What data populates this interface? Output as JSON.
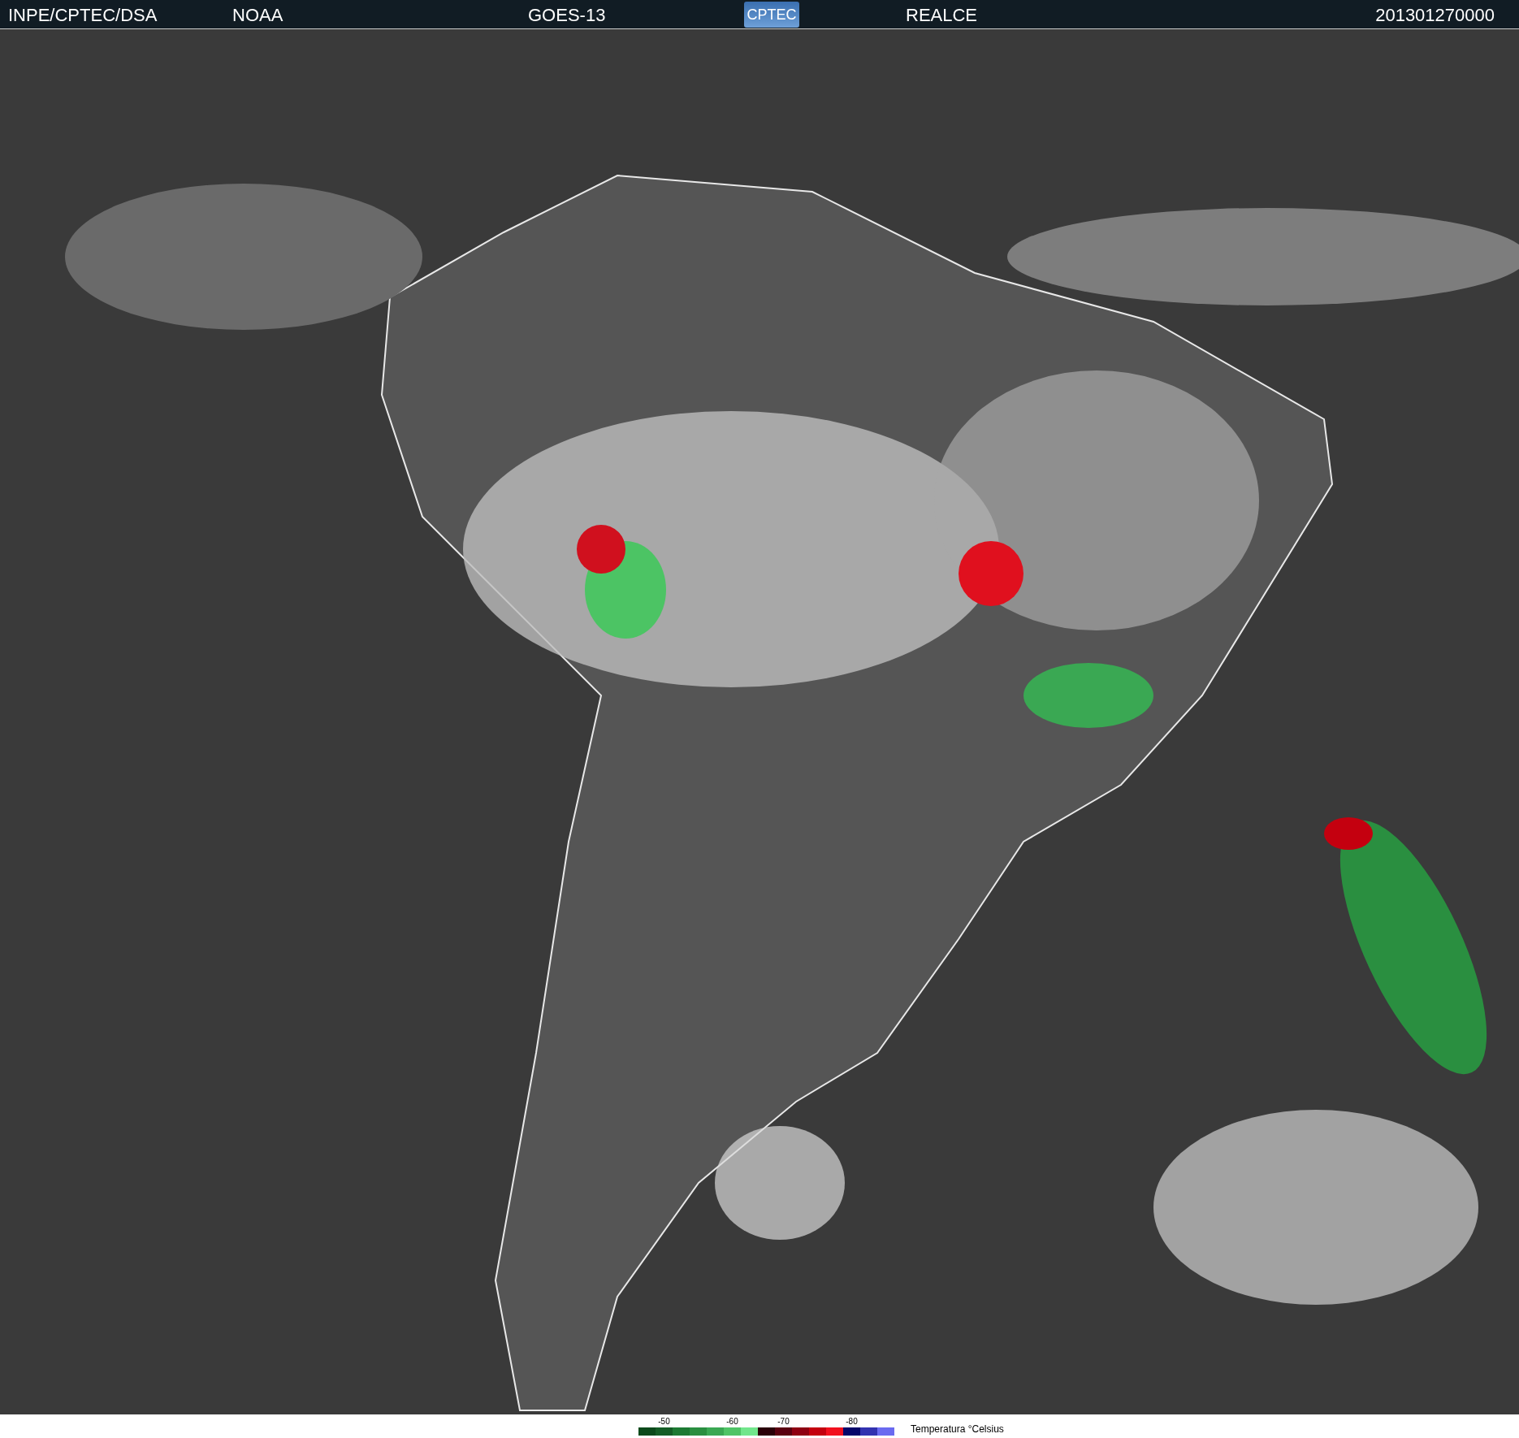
{
  "header": {
    "items": [
      "INPE/CPTEC/DSA",
      "NOAA",
      "GOES-13",
      "REALCE",
      "201301270000"
    ],
    "logo": "CPTEC"
  },
  "legend": {
    "title": "Temperatura °Celsius",
    "swatches": [
      {
        "color": "#0b4a1b"
      },
      {
        "color": "#145d26",
        "label": "-50"
      },
      {
        "color": "#1d7a33"
      },
      {
        "color": "#2a8f40"
      },
      {
        "color": "#3aa853"
      },
      {
        "color": "#4fc466",
        "label": "-60"
      },
      {
        "color": "#72e68c"
      },
      {
        "color": "#2a0008"
      },
      {
        "color": "#5a0010",
        "label": "-70"
      },
      {
        "color": "#8e0012"
      },
      {
        "color": "#c4000f"
      },
      {
        "color": "#f2101e"
      },
      {
        "color": "#06066a",
        "label": "-80"
      },
      {
        "color": "#3232b0"
      },
      {
        "color": "#6a6af0"
      }
    ]
  }
}
